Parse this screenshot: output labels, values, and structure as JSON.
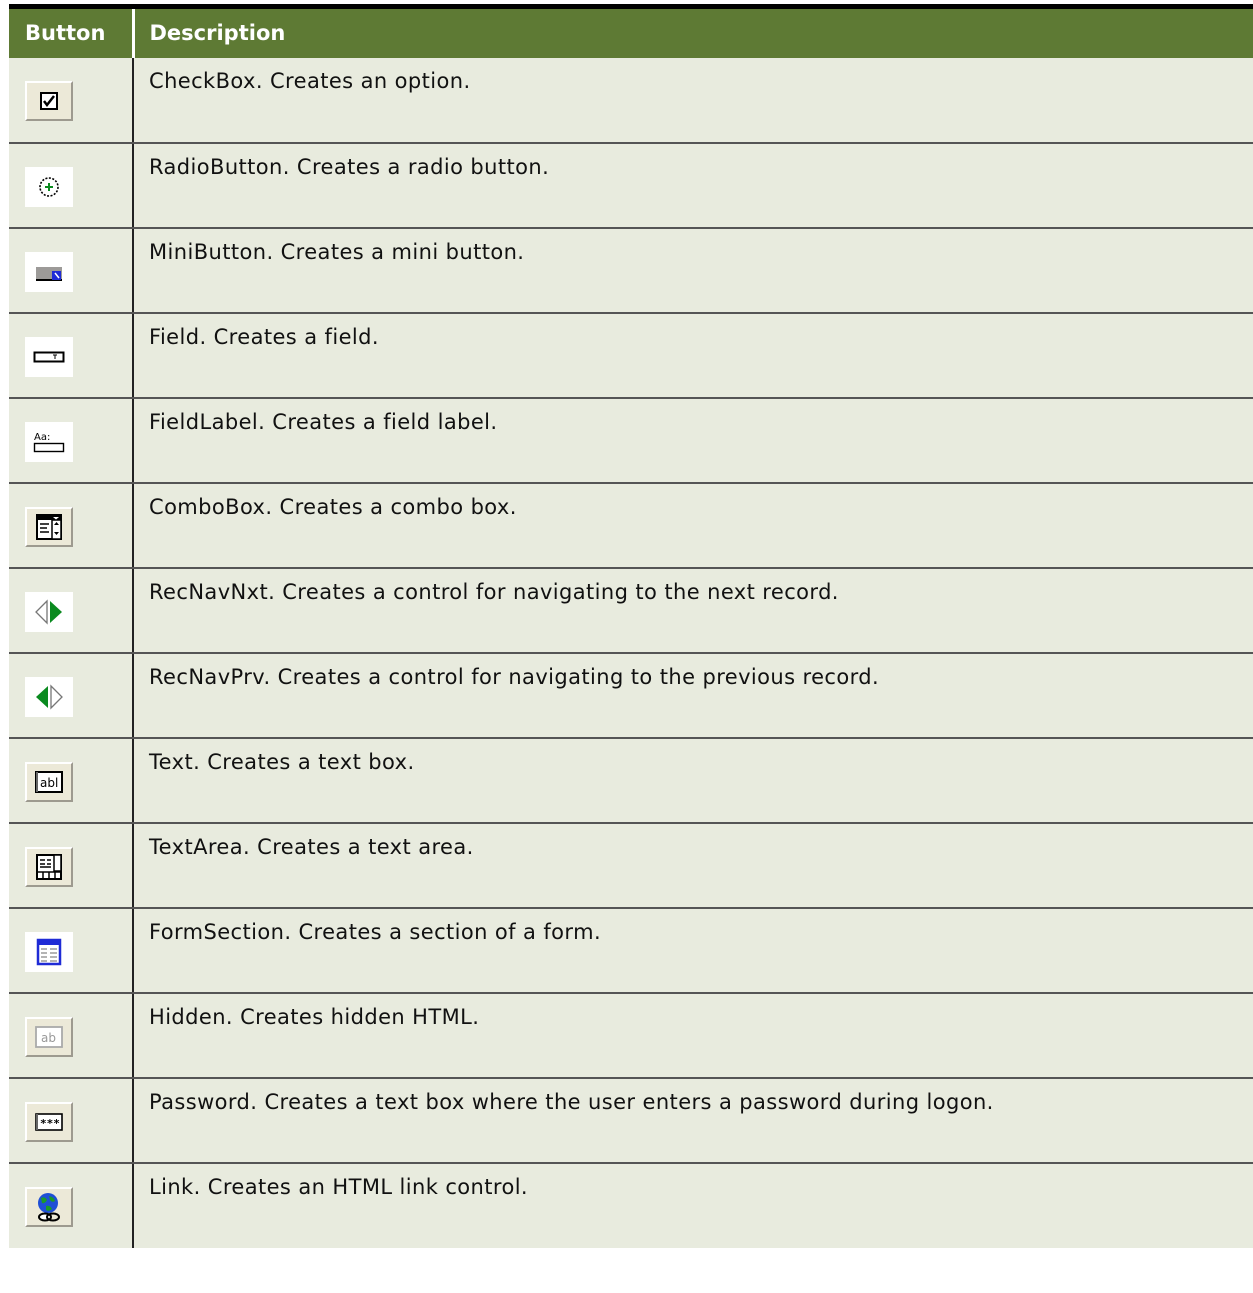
{
  "table": {
    "headers": {
      "button": "Button",
      "description": "Description"
    },
    "rows": [
      {
        "icon": "checkbox-icon",
        "description": "CheckBox. Creates an option."
      },
      {
        "icon": "radio-button-icon",
        "description": "RadioButton. Creates a radio button."
      },
      {
        "icon": "mini-button-icon",
        "description": "MiniButton. Creates a mini button."
      },
      {
        "icon": "field-icon",
        "description": "Field. Creates a field."
      },
      {
        "icon": "field-label-icon",
        "description": "FieldLabel. Creates a field label.",
        "icon_text": "Aa:"
      },
      {
        "icon": "combo-box-icon",
        "description": "ComboBox. Creates a combo box."
      },
      {
        "icon": "record-nav-next-icon",
        "description": "RecNavNxt. Creates a control for navigating to the next record."
      },
      {
        "icon": "record-nav-previous-icon",
        "description": "RecNavPrv. Creates a control for navigating to the previous record."
      },
      {
        "icon": "text-box-icon",
        "description": "Text. Creates a text box.",
        "icon_text": "abl"
      },
      {
        "icon": "text-area-icon",
        "description": "TextArea. Creates a text area."
      },
      {
        "icon": "form-section-icon",
        "description": "FormSection. Creates a section of a form."
      },
      {
        "icon": "hidden-icon",
        "description": "Hidden. Creates hidden HTML.",
        "icon_text": "ab"
      },
      {
        "icon": "password-icon",
        "description": "Password. Creates a text box where the user enters a password during logon.",
        "icon_text": "***"
      },
      {
        "icon": "link-globe-icon",
        "description": "Link. Creates an HTML link control."
      }
    ]
  },
  "colors": {
    "header_bg": "#5e7a34",
    "row_bg": "#e8ebde",
    "nav_green": "#0a8a1f",
    "form_blue": "#1f2bd6"
  }
}
